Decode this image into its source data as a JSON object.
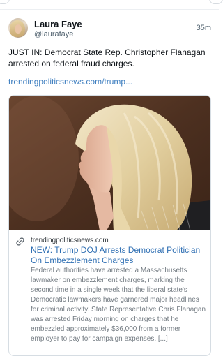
{
  "post": {
    "author_name": "Laura Faye",
    "author_handle": "@laurafaye",
    "time": "35m",
    "text": "JUST IN: Democrat State Rep. Christopher Flanagan arrested on federal fraud charges.",
    "link_text": "trendingpoliticsnews.com/trump..."
  },
  "card": {
    "domain": "trendingpoliticsnews.com",
    "title": "NEW: Trump DOJ Arrests Democrat Politician On Embezzlement Charges",
    "description": "Federal authorities have arrested a Massachusetts lawmaker on embezzlement charges, marking the second time in a single week that the liberal state's Democratic lawmakers have garnered major headlines for criminal activity. State Representative Chris Flanagan was arrested Friday morning on charges that he embezzled approximately $36,000 from a former employer to pay for campaign expenses, [...]",
    "link_icon": "link-icon"
  },
  "colors": {
    "link": "#3f7fc0",
    "card_title": "#2f6fb3",
    "muted": "#536471"
  }
}
